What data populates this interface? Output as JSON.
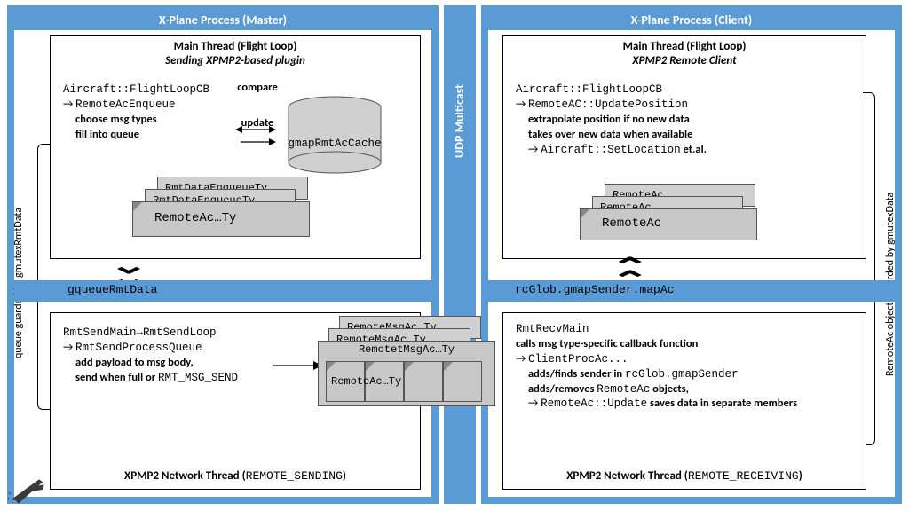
{
  "master": {
    "title": "X-Plane Process (Master)",
    "mutex_label": "queue guarded by gmutexRmtData",
    "main_thread": {
      "title_line1": "Main Thread (Flight Loop)",
      "title_line2": "Sending XPMP2-based plugin",
      "cb": "Aircraft::FlightLoopCB",
      "enq": "RemoteAcEnqueue",
      "desc1": "choose msg types",
      "desc2": "fill into queue",
      "compare": "compare",
      "update": "update",
      "cache": "gmapRmtAcCache",
      "stack_back": "RmtDataEnqueueTy",
      "stack_mid": "RmtDataEnqueueTy",
      "stack_front": "RemoteAc…Ty"
    },
    "hbar": "gqueueRmtData",
    "net_thread": {
      "l1": "RmtSendMain→RmtSendLoop",
      "l2": "RmtSendProcessQueue",
      "l3": "add payload to msg body,",
      "l4a": "send when full or ",
      "l4b": "RMT_MSG_SEND",
      "title_a": "XPMP2 Network Thread (",
      "title_b": "REMOTE_SENDING",
      "title_c": ")",
      "msg_back": "RemoteMsgAc…Ty",
      "msg_mid": "RemoteMsgAc…Ty",
      "msg_front": "RemotetMsgAc…Ty",
      "note": "RemoteAc…Ty"
    }
  },
  "udp": "UDP Multicast",
  "client": {
    "title": "X-Plane Process (Client)",
    "mutex_label": "RemoteAc objects guarded by gmutexData",
    "main_thread": {
      "title_line1": "Main Thread (Flight Loop)",
      "title_line2": "XPMP2 Remote Client",
      "cb": "Aircraft::FlightLoopCB",
      "upd": "RemoteAC::UpdatePosition",
      "desc1": "extrapolate position if no new data",
      "desc2": "takes over new data when available",
      "setloc_a": "Aircraft::SetLocation",
      "setloc_b": " et.al.",
      "stack_back": "RemoteAc",
      "stack_mid": "RemoteAc",
      "stack_front": "RemoteAc"
    },
    "hbar": "rcGlob.gmapSender.mapAc",
    "net_thread": {
      "l1": "RmtRecvMain",
      "l2": "calls msg type-specific callback function",
      "l3": "ClientProcAc...",
      "l4a": "adds/finds sender in ",
      "l4b": "rcGlob.gmapSender",
      "l5a": "adds/removes ",
      "l5b": "RemoteAc",
      "l5c": " objects,",
      "l6a": "RemoteAc::Update",
      "l6b": " saves data in separate members",
      "title_a": "XPMP2 Network Thread (",
      "title_b": "REMOTE_RECEIVING",
      "title_c": ")"
    }
  }
}
